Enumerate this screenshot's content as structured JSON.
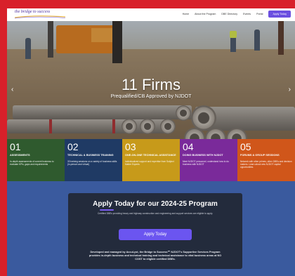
{
  "brand": {
    "logo_text": "the bridge to success",
    "accent": "#6b4fe0"
  },
  "nav": {
    "items": [
      "Home",
      "About the Program",
      "DBE Directory",
      "Events",
      "Portal"
    ],
    "cta": "Apply Today"
  },
  "hero": {
    "title": "11 Firms",
    "subtitle": "Prequalified/CB Approved by NJDOT",
    "prev": "‹",
    "next": "›"
  },
  "cards": [
    {
      "num": "01",
      "title": "ASSESSMENTS",
      "desc": "In-depth assessments of current business to evaluate KPIs, gaps and requirements",
      "color": "#2f5a2e"
    },
    {
      "num": "02",
      "title": "TECHNICAL & BUSINESS TRAINING",
      "desc": "33 training sessions on a variety of business skills (in-person and virtual)",
      "color": "#1f3a64"
    },
    {
      "num": "03",
      "title": "ONE-ON-ONE TECHNICAL ASSISTANCE",
      "desc": "Individualized support and expertise from Subject Matter Experts",
      "color": "#c79a1a"
    },
    {
      "num": "04",
      "title": "DOING BUSINESS WITH NJDOT",
      "desc": "Meet NJDOT personnel, understand how to do business with NJDOT",
      "color": "#7a2a9a"
    },
    {
      "num": "05",
      "title": "FORUMS & GROUP SESSIONS",
      "desc": "Network with other primes, other DBEs and decision makers. Learn about new NJDOT capital opportunities.",
      "color": "#d0561a"
    }
  ],
  "apply": {
    "title": "Apply Today for our 2024-25 Program",
    "desc": "Certified DBEs providing heavy and highway construction and engineering and support services are eligible to apply.",
    "button": "Apply Today",
    "footer": "Developed and managed by AccuLyst, the Bridge to Success℠ NJDOT's Supportive Services Program provides in-depth business and technical training and technical assistance to vital business areas at NO COST to eligible certified DBEs."
  }
}
